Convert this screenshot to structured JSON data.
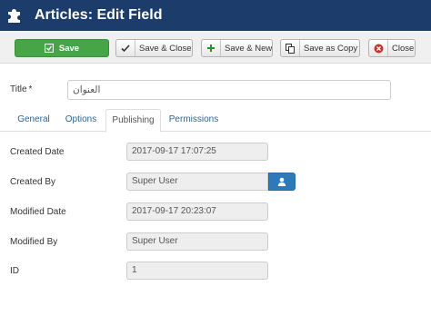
{
  "header": {
    "title": "Articles: Edit Field",
    "icon": "puzzle-icon",
    "bg_color": "#1c3c6b"
  },
  "toolbar": {
    "save": {
      "label": "Save",
      "icon": "save-icon",
      "color": "#46a546"
    },
    "save_close": {
      "label": "Save & Close",
      "icon": "check-icon"
    },
    "save_new": {
      "label": "Save & New",
      "icon": "plus-icon"
    },
    "save_copy": {
      "label": "Save as Copy",
      "icon": "copy-icon"
    },
    "close": {
      "label": "Close",
      "icon": "cancel-icon"
    }
  },
  "form": {
    "title_label": "Title",
    "title_required": "*",
    "title_value": "العنوان"
  },
  "tabs": [
    {
      "label": "General",
      "active": false
    },
    {
      "label": "Options",
      "active": false
    },
    {
      "label": "Publishing",
      "active": true
    },
    {
      "label": "Permissions",
      "active": false
    }
  ],
  "publishing": {
    "created_date": {
      "label": "Created Date",
      "value": "2017-09-17 17:07:25"
    },
    "created_by": {
      "label": "Created By",
      "value": "Super User",
      "button_icon": "user-icon"
    },
    "modified_date": {
      "label": "Modified Date",
      "value": "2017-09-17 20:23:07"
    },
    "modified_by": {
      "label": "Modified By",
      "value": "Super User"
    },
    "id": {
      "label": "ID",
      "value": "1"
    }
  }
}
